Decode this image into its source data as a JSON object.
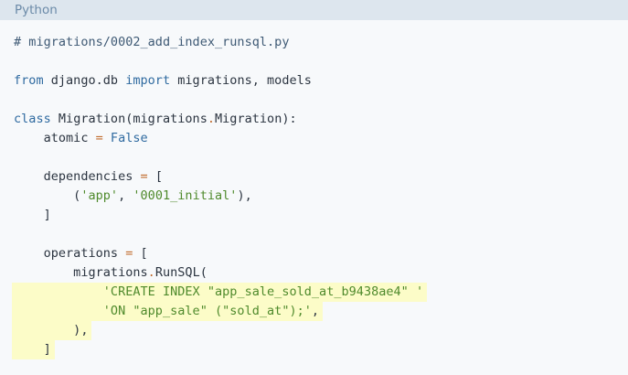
{
  "header": {
    "language": "Python"
  },
  "code": {
    "comment": "# migrations/0002_add_index_runsql.py",
    "kw_from": "from",
    "mod": " django.db ",
    "kw_import": "import",
    "imports": " migrations, models",
    "kw_class": "class",
    "class_sig": " Migration(migrations",
    "class_dot": ".",
    "class_base": "Migration):",
    "atomic_name": "    atomic ",
    "eq1": "=",
    "false_val": " False",
    "deps_name": "    dependencies ",
    "eq2": "=",
    "deps_open": " [",
    "tuple_open": "        (",
    "str_app": "'app'",
    "comma1": ", ",
    "str_initial": "'0001_initial'",
    "tuple_close": "),",
    "deps_close": "    ]",
    "ops_name": "    operations ",
    "eq3": "=",
    "ops_open": " [",
    "runsql_prefix": "        migrations",
    "runsql_dot": ".",
    "runsql_call": "RunSQL(",
    "sql_line1": "            'CREATE INDEX \"app_sale_sold_at_b9438ae4\" '",
    "sql_line2_str": "            'ON \"app_sale\" (\"sold_at\");'",
    "sql_line2_comma": ",",
    "call_close": "        ),",
    "ops_close": "    ]"
  }
}
